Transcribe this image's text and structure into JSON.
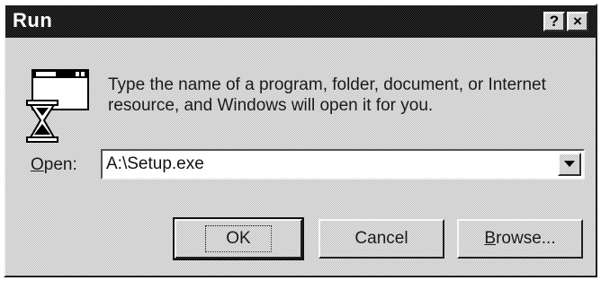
{
  "window": {
    "title": "Run"
  },
  "titlebar": {
    "help_label": "?",
    "close_label": "×"
  },
  "icons": {
    "app_icon": "run-program-icon",
    "help": "help-icon",
    "close": "close-icon",
    "dropdown": "chevron-down-icon"
  },
  "description": "Type the name of a program, folder, document, or Internet resource, and Windows will open it for you.",
  "open": {
    "label_mnemonic": "O",
    "label_rest": "pen:",
    "value": "A:\\Setup.exe"
  },
  "buttons": {
    "ok": "OK",
    "cancel": "Cancel",
    "browse_mnemonic": "B",
    "browse_rest": "rowse..."
  },
  "colors": {
    "titlebar": "#000000",
    "title_text": "#ffffff",
    "dialog_face": "#d9d9d9"
  }
}
